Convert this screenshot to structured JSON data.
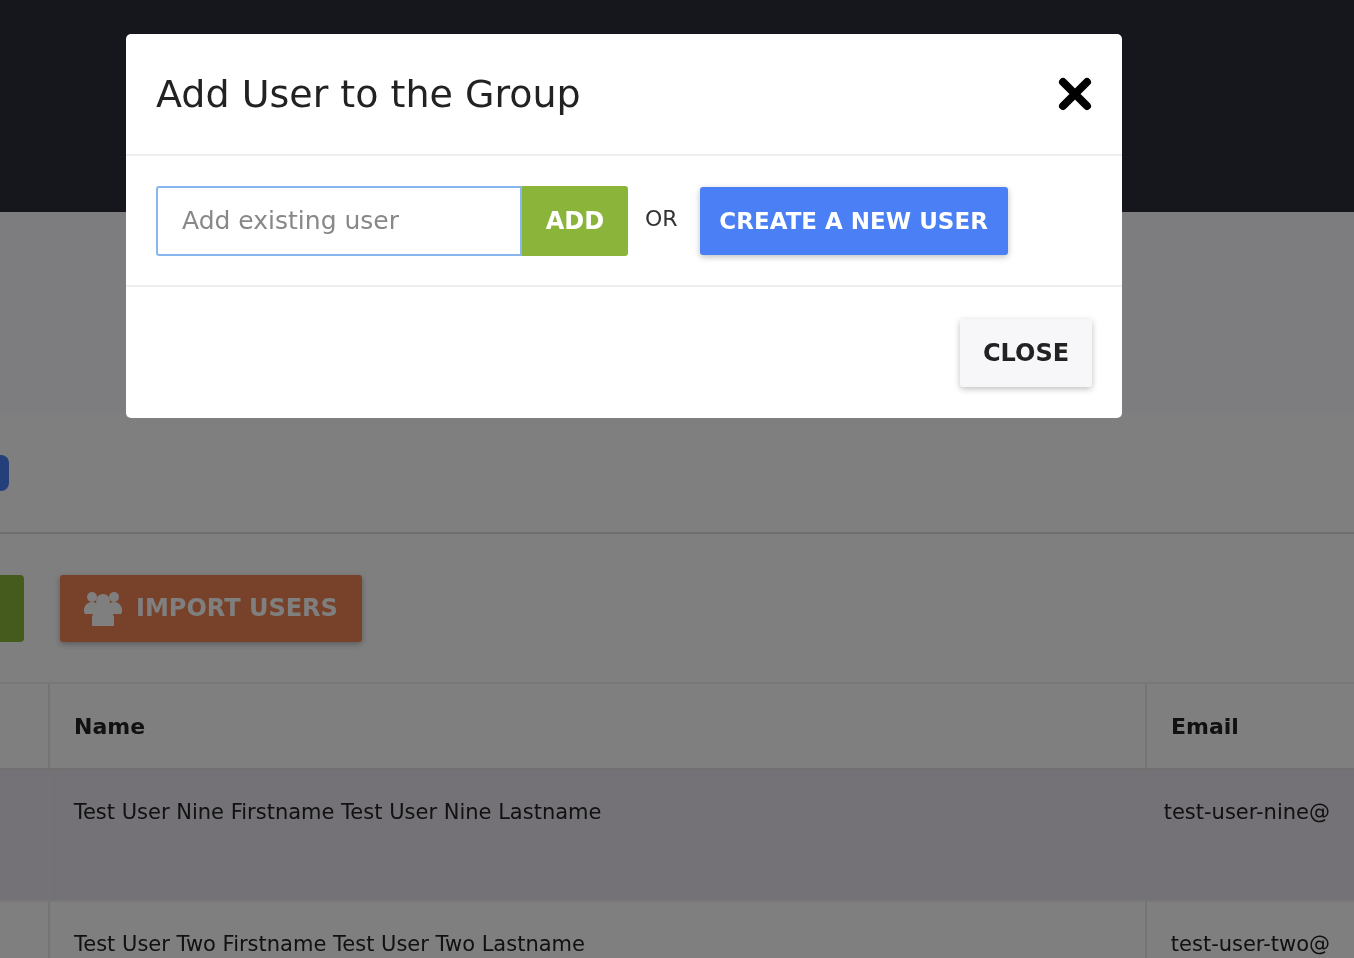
{
  "page": {
    "toolbar_buttons": [
      {
        "label": "IMPORT USERS"
      }
    ],
    "table": {
      "columns": [
        "Name",
        "Email"
      ],
      "rows": [
        {
          "name": "Test User Nine Firstname Test User Nine Lastname",
          "email": "test-user-nine@",
          "selected": true
        },
        {
          "name": "Test User Two Firstname Test User Two Lastname",
          "email": "test-user-two@",
          "selected": false
        }
      ]
    }
  },
  "dialog": {
    "title": "Add User to the Group",
    "user_field": {
      "placeholder": "Add existing user"
    },
    "add_button": "ADD",
    "separator": "OR",
    "create_button": "CREATE A NEW USER",
    "footer_buttons": [
      "CLOSE"
    ]
  }
}
